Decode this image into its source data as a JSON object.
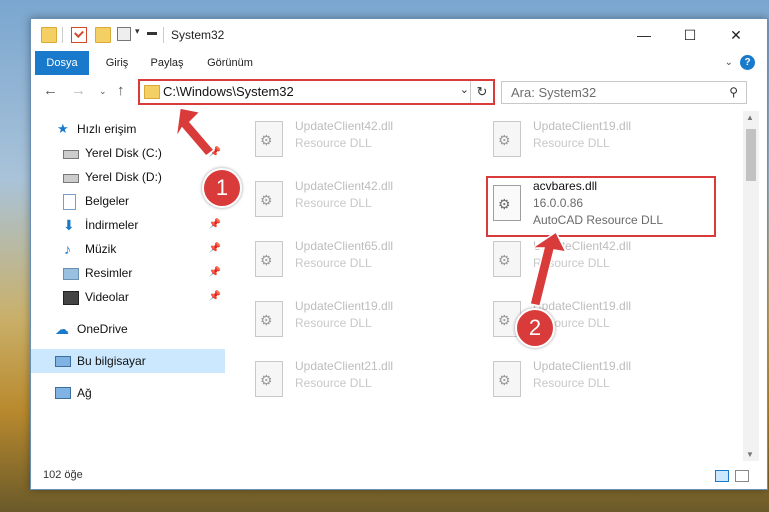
{
  "window": {
    "title": "System32",
    "buttons": {
      "minimize": "—",
      "maximize": "☐",
      "close": "✕"
    }
  },
  "ribbon": {
    "tabs": [
      "Dosya",
      "Giriş",
      "Paylaş",
      "Görünüm"
    ],
    "help": "?"
  },
  "address": {
    "path": "C:\\Windows\\System32",
    "chevron": "⌄",
    "refresh": "↻"
  },
  "search": {
    "placeholder": "Ara: System32",
    "icon": "⚲"
  },
  "nav": {
    "items": [
      {
        "label": "Hızlı erişim",
        "icon": "star-icon"
      },
      {
        "label": "Yerel Disk (C:)",
        "icon": "drive-icon"
      },
      {
        "label": "Yerel Disk (D:)",
        "icon": "drive-icon"
      },
      {
        "label": "Belgeler",
        "icon": "documents-icon"
      },
      {
        "label": "İndirmeler",
        "icon": "download-icon"
      },
      {
        "label": "Müzik",
        "icon": "music-icon"
      },
      {
        "label": "Resimler",
        "icon": "pictures-icon"
      },
      {
        "label": "Videolar",
        "icon": "video-icon"
      },
      {
        "label": "OneDrive",
        "icon": "cloud-icon"
      },
      {
        "label": "Bu bilgisayar",
        "icon": "computer-icon"
      },
      {
        "label": "Ağ",
        "icon": "network-icon"
      }
    ]
  },
  "files": [
    {
      "name": "UpdateClient42.dll",
      "desc": "Resource DLL"
    },
    {
      "name": "UpdateClient19.dll",
      "desc": "Resource DLL"
    },
    {
      "name": "UpdateClient42.dll",
      "desc": "Resource DLL"
    },
    {
      "name": "acvbares.dll",
      "version": "16.0.0.86",
      "desc": "AutoCAD Resource DLL"
    },
    {
      "name": "UpdateClient65.dll",
      "desc": "Resource DLL"
    },
    {
      "name": "UpdateClient42.dll",
      "desc": "Resource DLL"
    },
    {
      "name": "UpdateClient19.dll",
      "desc": "Resource DLL"
    },
    {
      "name": "UpdateClient19.dll",
      "desc": "Resource DLL"
    },
    {
      "name": "UpdateClient21.dll",
      "desc": "Resource DLL"
    },
    {
      "name": "UpdateClient19.dll",
      "desc": "Resource DLL"
    }
  ],
  "status": {
    "count": "102 öğe"
  },
  "annotations": {
    "badge1": "1",
    "badge2": "2",
    "color": "#d93a3a"
  }
}
